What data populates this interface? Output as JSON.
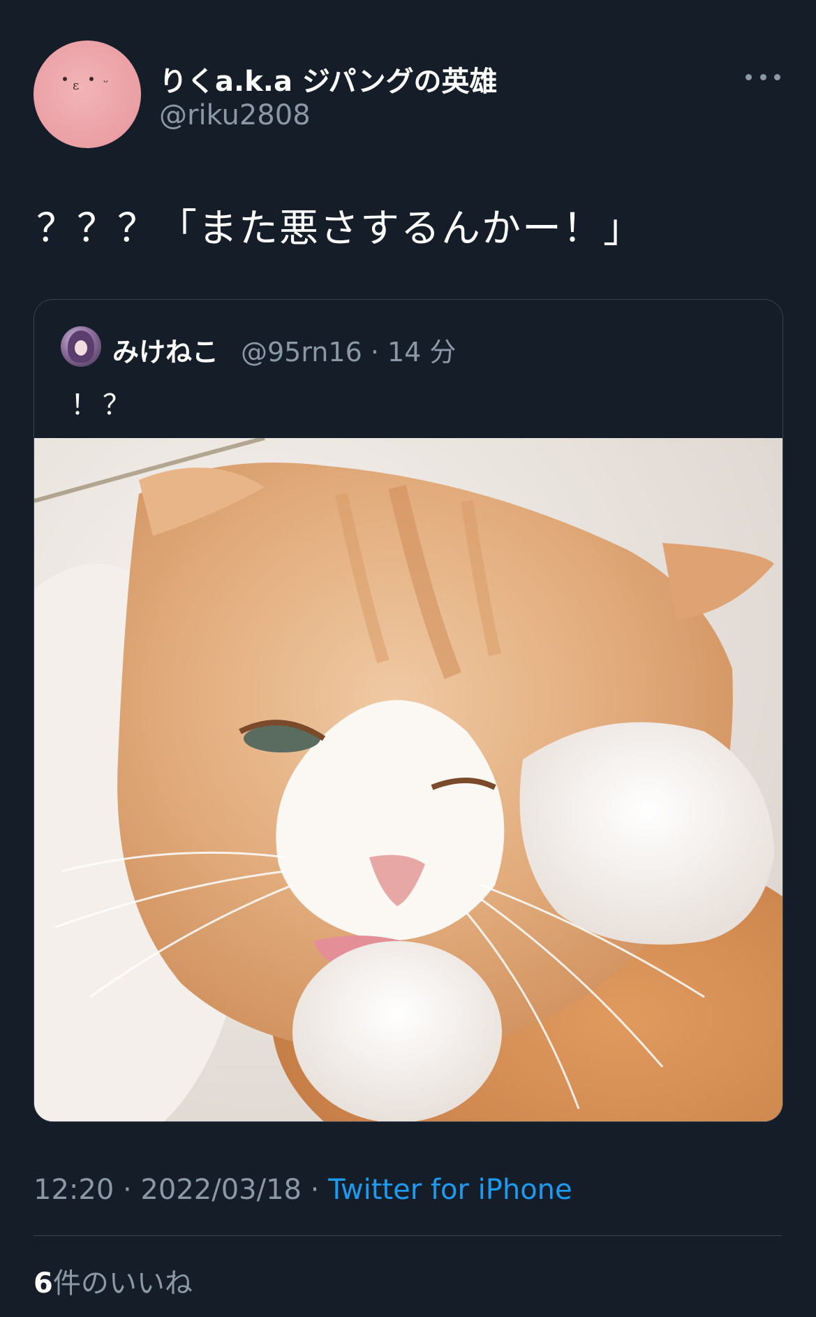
{
  "author": {
    "display_name": "りくa.k.a ジパングの英雄",
    "handle": "@riku2808",
    "avatar_color": "#ea9fa4"
  },
  "more_icon": "more-horizontal-icon",
  "tweet": {
    "text": "？？？「また悪さするんかー！」"
  },
  "quoted_tweet": {
    "display_name": "みけねこ",
    "meta": "@95rn16 · 14 分",
    "text": "！？",
    "image_subject": "orange and white cat lying on white sheets with paw raised"
  },
  "footer": {
    "time_and_date": "12:20 · 2022/03/18 · ",
    "source": "Twitter for iPhone",
    "likes_count": "6",
    "likes_label": "件のいいね"
  },
  "colors": {
    "background": "#151d28",
    "secondary_text": "#8b98a5",
    "link": "#1d9bf0",
    "border": "#38444d"
  }
}
